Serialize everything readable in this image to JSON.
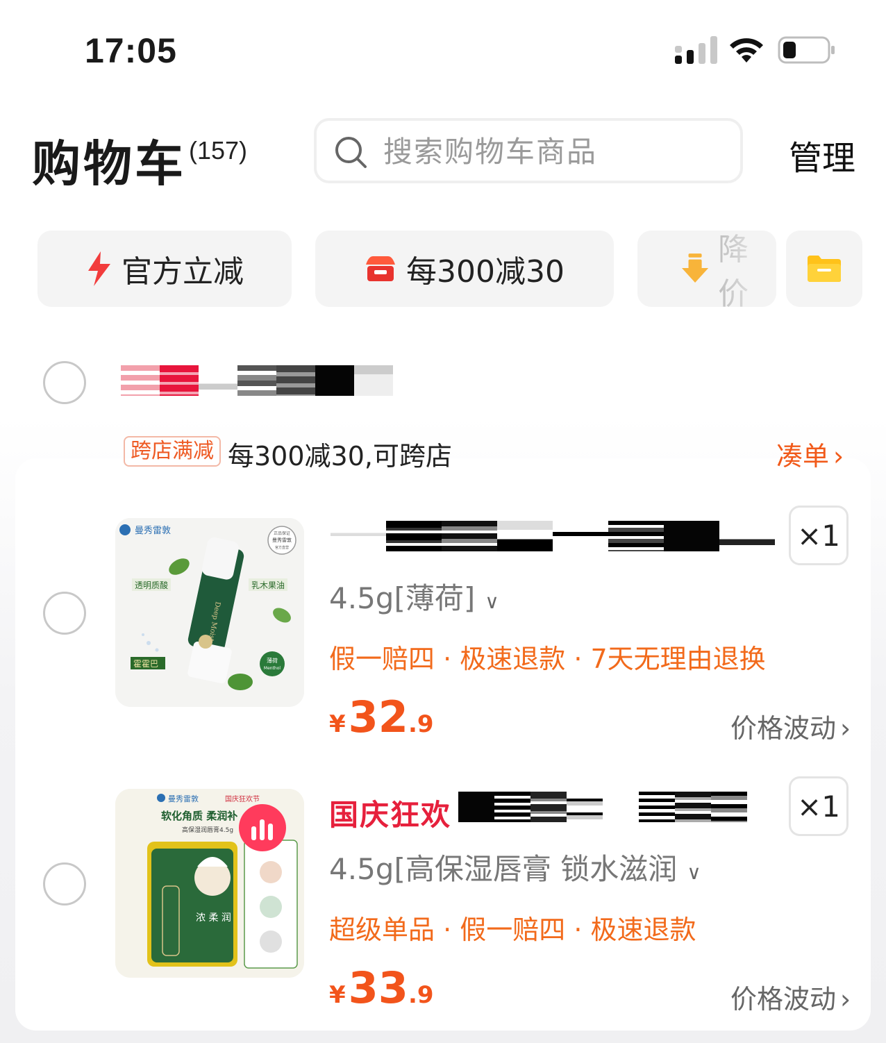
{
  "status_bar": {
    "time": "17:05"
  },
  "header": {
    "title": "购物车",
    "count": "(157)",
    "search_placeholder": "搜索购物车商品",
    "manage_label": "管理"
  },
  "filters": [
    {
      "label": "官方立减",
      "icon": "lightning-icon"
    },
    {
      "label": "每300减30",
      "icon": "store-icon"
    },
    {
      "label": "降价",
      "icon": "arrow-down-icon"
    },
    {
      "label": "",
      "icon": "folder-icon"
    }
  ],
  "store": {
    "promo_tag": "跨店满减",
    "promo_text": "每300减30,可跨店",
    "promo_link": "凑单",
    "promo_link_chevron": "›"
  },
  "items": [
    {
      "variant": "4.5g[薄荷]",
      "tags": "假一赔四 · 极速退款 · 7天无理由退换",
      "price_symbol": "¥",
      "price_int": "32",
      "price_dec": ".9",
      "qty": "×1",
      "fluctuation": "价格波动",
      "image_brand": "曼秀雷敦",
      "image_label_left": "透明质酸",
      "image_label_right": "乳木果油",
      "image_label_bottom": "霍霍巴",
      "image_label_flavor": "薄荷",
      "image_label_menthol": "Menthol",
      "image_product_name": "Deep Moist",
      "image_seal_text": "曼秀雷敦",
      "image_seal_sub": "官方直营",
      "image_seal_top": "正品保证"
    },
    {
      "festival": "国庆狂欢",
      "variant": "4.5g[高保湿唇膏 锁水滋润",
      "tags": "超级单品 · 假一赔四 · 极速退款",
      "price_symbol": "¥",
      "price_int": "33",
      "price_dec": ".9",
      "qty": "×1",
      "fluctuation": "价格波动",
      "image_brand": "曼秀雷敦",
      "image_badge": "国庆狂欢节",
      "image_headline": "软化角质 柔润补",
      "image_sub": "高保湿润唇膏4.5g",
      "image_product_label": "浓 柔 润"
    }
  ],
  "colors": {
    "accent_orange": "#f15a1a",
    "festival_red": "#e6203c",
    "tag_orange": "#f26a1b",
    "price": "#f2541b"
  }
}
